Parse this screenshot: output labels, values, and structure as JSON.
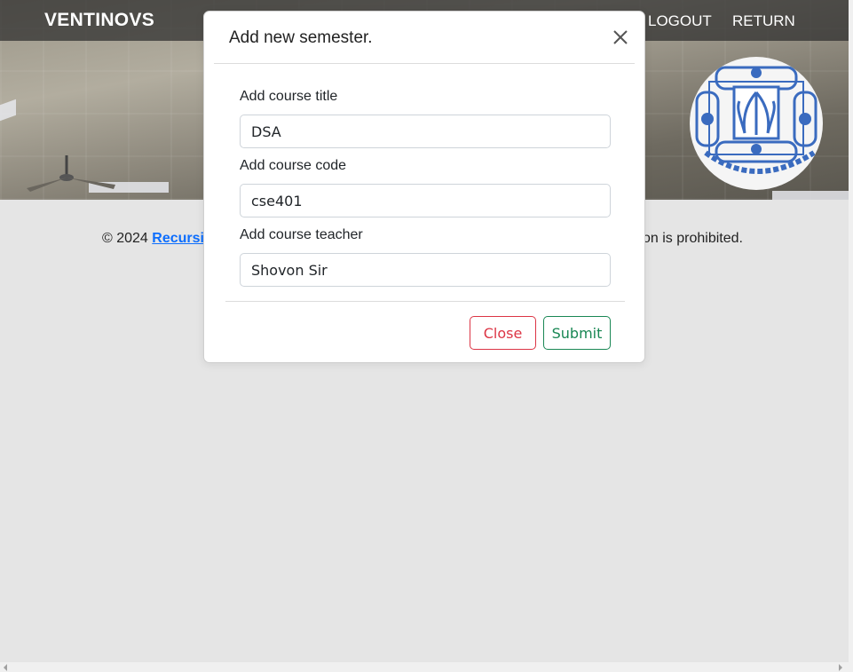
{
  "nav": {
    "brand": "VENTINOVS",
    "links": [
      "LOGOUT",
      "RETURN"
    ]
  },
  "hero": {
    "emblem_icon": "university-emblem-icon"
  },
  "footer": {
    "prefix": "© 2024 ",
    "link_text": "Recursiv",
    "suffix": "on is prohibited."
  },
  "modal": {
    "title": "Add new semester.",
    "fields": [
      {
        "label": "Add course title",
        "value": "DSA"
      },
      {
        "label": "Add course code",
        "value": "cse401"
      },
      {
        "label": "Add course teacher",
        "value": "Shovon Sir"
      }
    ],
    "close_label": "Close",
    "submit_label": "Submit"
  },
  "colors": {
    "danger": "#dc3545",
    "success": "#198754",
    "link": "#0d6efd",
    "emblem": "#3a6bbf"
  }
}
